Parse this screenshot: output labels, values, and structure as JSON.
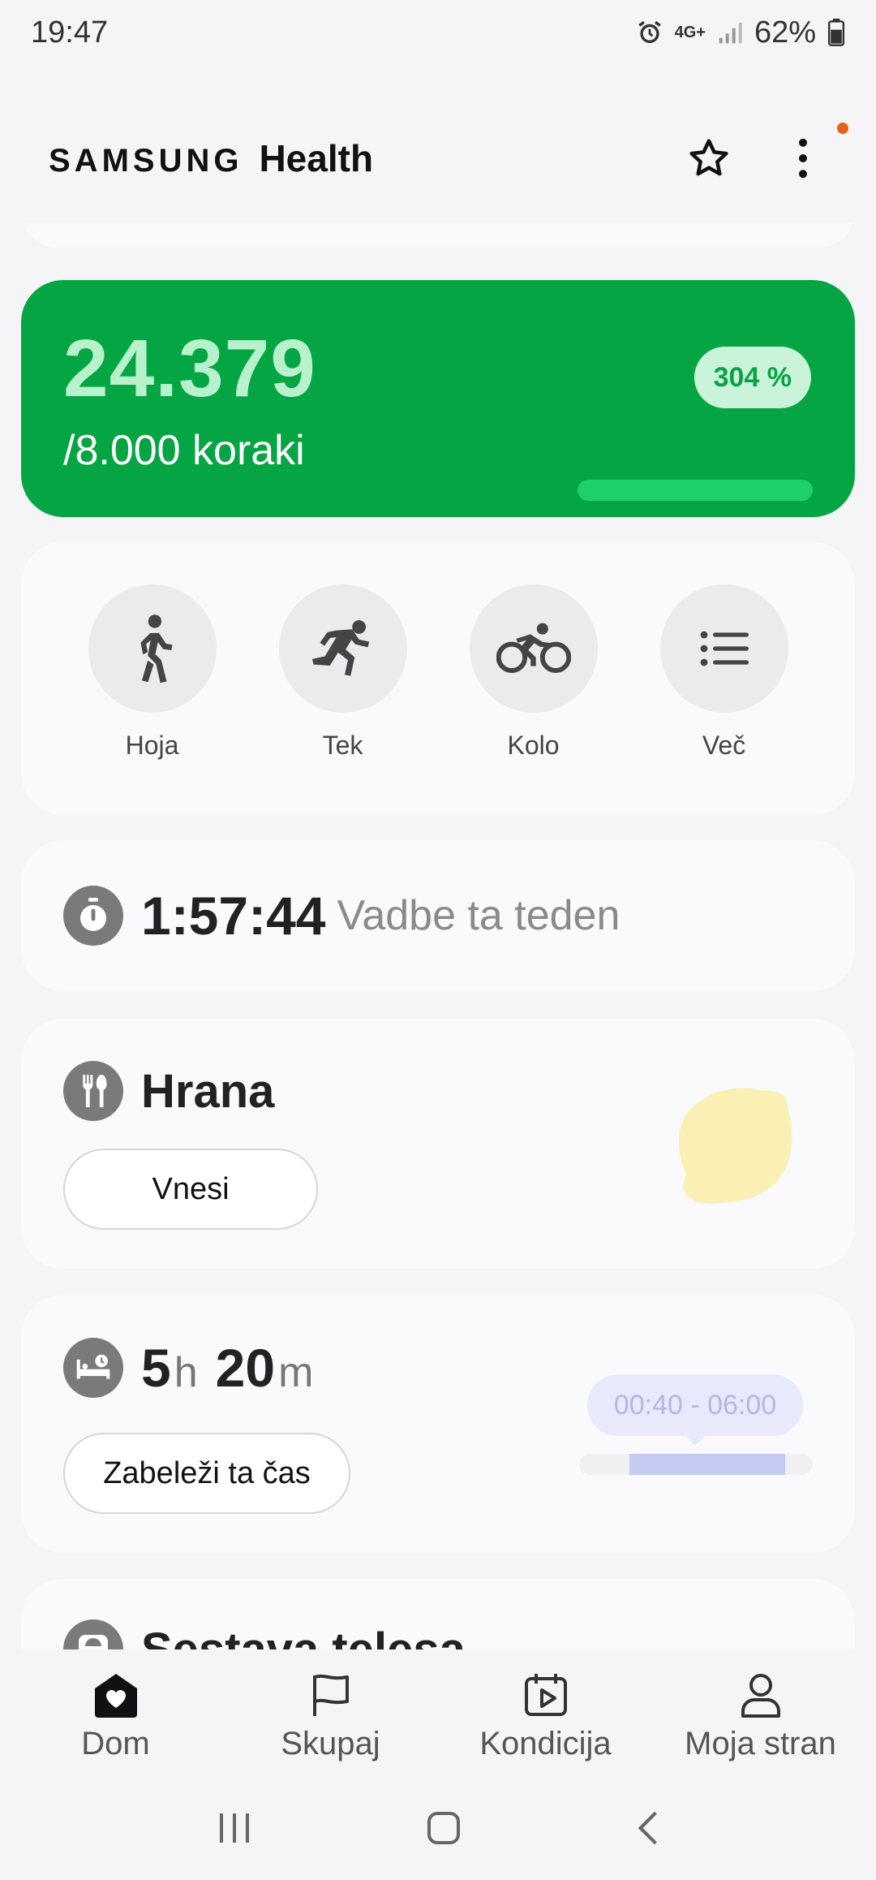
{
  "status": {
    "time": "19:47",
    "network": "4G+",
    "battery": "62%"
  },
  "app": {
    "brand": "SAMSUNG",
    "name": "Health"
  },
  "steps": {
    "count": "24.379",
    "goal": "/8.000 koraki",
    "percent_label": "304 %",
    "progress_fraction": 1.0
  },
  "activities": [
    {
      "label": "Hoja",
      "icon": "walk-icon"
    },
    {
      "label": "Tek",
      "icon": "run-icon"
    },
    {
      "label": "Kolo",
      "icon": "bike-icon"
    },
    {
      "label": "Več",
      "icon": "list-icon"
    }
  ],
  "workout": {
    "time": "1:57:44",
    "label": "Vadbe ta teden"
  },
  "food": {
    "title": "Hrana",
    "button": "Vnesi"
  },
  "sleep": {
    "hours": "5",
    "hours_unit": "h",
    "minutes": "20",
    "minutes_unit": "m",
    "button": "Zabeleži ta čas",
    "range": "00:40 - 06:00"
  },
  "body": {
    "title": "Sestava telesa"
  },
  "nav": [
    {
      "label": "Dom",
      "icon": "home-heart-icon"
    },
    {
      "label": "Skupaj",
      "icon": "flag-icon"
    },
    {
      "label": "Kondicija",
      "icon": "calendar-play-icon"
    },
    {
      "label": "Moja stran",
      "icon": "person-icon"
    }
  ],
  "colors": {
    "steps_bg": "#05a543",
    "steps_accent": "#1ed06a",
    "notification": "#e8601c",
    "sleep_range": "#c3cbf3"
  }
}
